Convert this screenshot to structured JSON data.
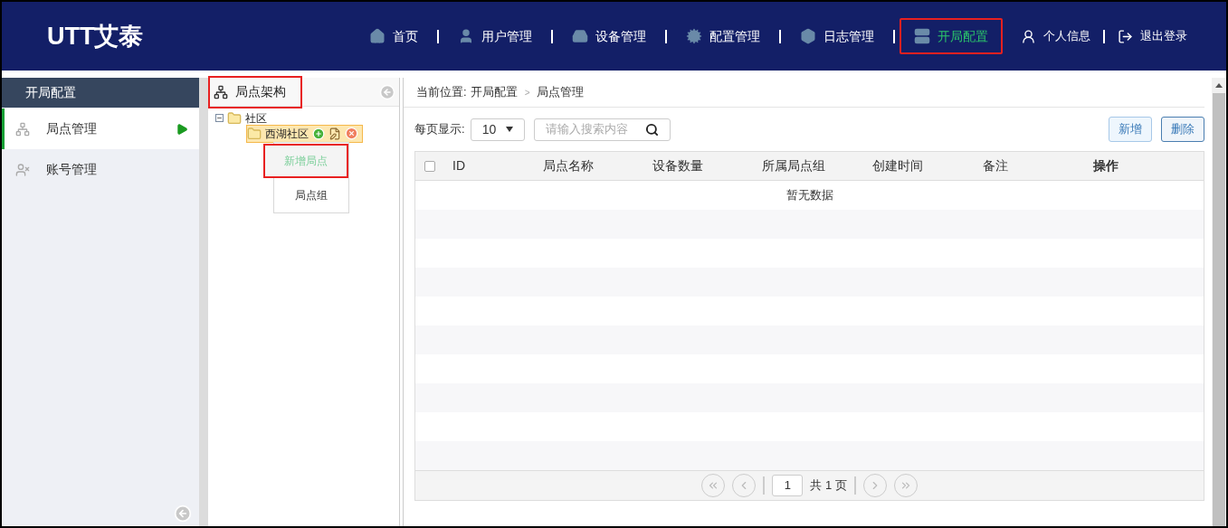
{
  "header": {
    "logo": "UTT艾泰",
    "nav": [
      {
        "label": "首页",
        "selected": false,
        "highlighted": false
      },
      {
        "label": "用户管理",
        "selected": false,
        "highlighted": false
      },
      {
        "label": "设备管理",
        "selected": false,
        "highlighted": false
      },
      {
        "label": "配置管理",
        "selected": false,
        "highlighted": false
      },
      {
        "label": "日志管理",
        "selected": false,
        "highlighted": false
      },
      {
        "label": "开局配置",
        "selected": true,
        "highlighted": true
      }
    ],
    "user_links": [
      {
        "label": "个人信息"
      },
      {
        "label": "退出登录"
      }
    ]
  },
  "sidebar": {
    "title": "开局配置",
    "items": [
      {
        "label": "局点管理",
        "selected": true
      },
      {
        "label": "账号管理",
        "selected": false
      }
    ]
  },
  "tree_panel": {
    "title": "局点架构",
    "highlighted": true,
    "tree": [
      {
        "label": "社区",
        "expanded": true,
        "selected": false,
        "children": [
          {
            "label": "西湖社区",
            "selected": true
          }
        ]
      }
    ],
    "context_menu": [
      {
        "label": "新增局点",
        "selected": true,
        "highlighted": true
      },
      {
        "label": "局点组",
        "selected": false,
        "highlighted": false
      }
    ]
  },
  "main": {
    "breadcrumb_label": "当前位置:",
    "breadcrumb": [
      "开局配置",
      "局点管理"
    ],
    "breadcrumb_separator": ">",
    "page_size_label": "每页显示:",
    "page_size": "10",
    "search": {
      "placeholder": "请输入搜索内容"
    },
    "buttons": [
      "新增",
      "删除"
    ],
    "table": {
      "select_all_checked": false,
      "columns": [
        "ID",
        "局点名称",
        "设备数量",
        "所属局点组",
        "创建时间",
        "备注",
        "操作"
      ],
      "empty_text": "暂无数据"
    },
    "pagination": {
      "page": "1",
      "total": "共 1 页"
    }
  }
}
